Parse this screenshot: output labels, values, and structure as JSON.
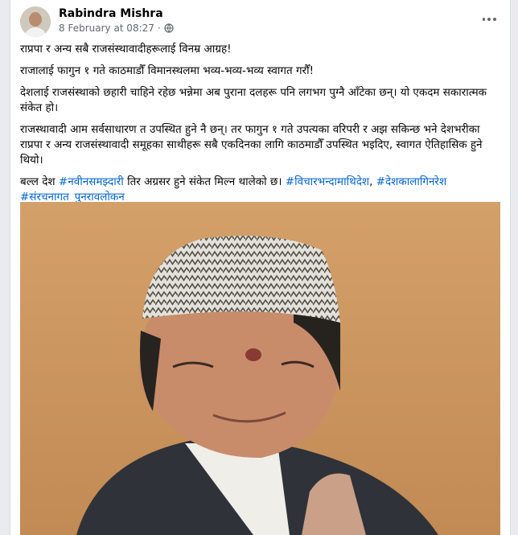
{
  "post": {
    "author": "Rabindra Mishra",
    "timestamp": "8 February at 08:27",
    "separator": "·",
    "paragraphs": {
      "p1": "राप्रपा र अन्य सबै राजसंस्थावादीहरूलाई विनम्र आग्रह!",
      "p2": "राजालाई फागुन १ गते काठमाडौँ विमानस्थलमा भव्य-भव्य-भव्य स्वागत गरौँ!",
      "p3": "देशलाई राजसंस्थाको छहारी चाहिने रहेछ भन्नेमा अब पुराना दलहरू पनि लगभग पुग्नै आँटेका छन्। यो एकदम सकारात्मक संकेत हो।",
      "p4": "राजस्थावादी आम सर्वसाधारण त उपस्थित हुने नै छन्। तर फागुन १ गते उपत्यका वरिपरी र अझ सकिन्छ भने देशभरीका राप्रपा र अन्य राजसंस्थावादी समूहका साथीहरू सबै एकदिनका लागि काठमाडौँ उपस्थित भइदिए, स्वागत ऐतिहासिक हुने थियो।",
      "p5_prefix": "बल्ल देश ",
      "p5_tag1": "#नवीनसमझ्दारी",
      "p5_middle": " तिर अग्रसर हुने संकेत मिल्न थालेको छ। ",
      "p5_tag2": "#विचारभन्दामाथिदेश",
      "p5_comma": ", ",
      "p5_tag3": "#देशकालागिनरेश",
      "p5_space": " ",
      "p5_tag4": "#संरचनागत_पुनरावलोकन"
    }
  },
  "colors": {
    "link": "#0064d1",
    "photo_background": "#cf9b62"
  },
  "icons": {
    "privacy": "globe-icon",
    "more": "more-options-icon"
  }
}
